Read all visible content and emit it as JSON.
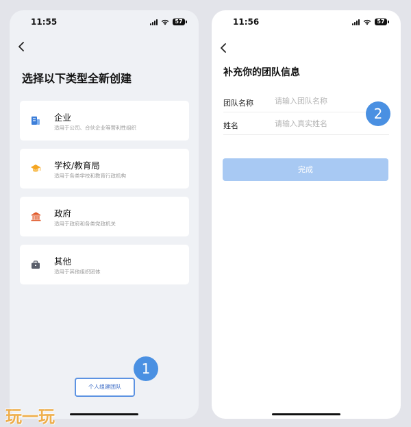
{
  "left_screen": {
    "status_time": "11:55",
    "battery": "57",
    "title": "选择以下类型全新创建",
    "cards": [
      {
        "title": "企业",
        "desc": "适用于公司、合伙企业等营利性组织",
        "icon": "building-icon"
      },
      {
        "title": "学校/教育局",
        "desc": "适用于各类学校和教育行政机构",
        "icon": "graduation-cap-icon"
      },
      {
        "title": "政府",
        "desc": "适用于政府和各类党政机关",
        "icon": "government-building-icon"
      },
      {
        "title": "其他",
        "desc": "适用于其他组织团体",
        "icon": "briefcase-icon"
      }
    ],
    "personal_button": "个人组建团队",
    "step_badge": "1"
  },
  "right_screen": {
    "status_time": "11:56",
    "battery": "57",
    "title": "补充你的团队信息",
    "fields": [
      {
        "label": "团队名称",
        "placeholder": "请输入团队名称",
        "value": ""
      },
      {
        "label": "姓名",
        "placeholder": "请输入真实姓名",
        "value": ""
      }
    ],
    "submit_button": "完成",
    "step_badge": "2"
  },
  "watermark": "玩一玩",
  "colors": {
    "accent": "#4a90e2",
    "submit_disabled": "#a8c9f3",
    "enterprise_icon": "#3d7fd9",
    "school_icon": "#f5a623",
    "government_icon": "#e05a2b",
    "other_icon": "#5a5f6b"
  }
}
